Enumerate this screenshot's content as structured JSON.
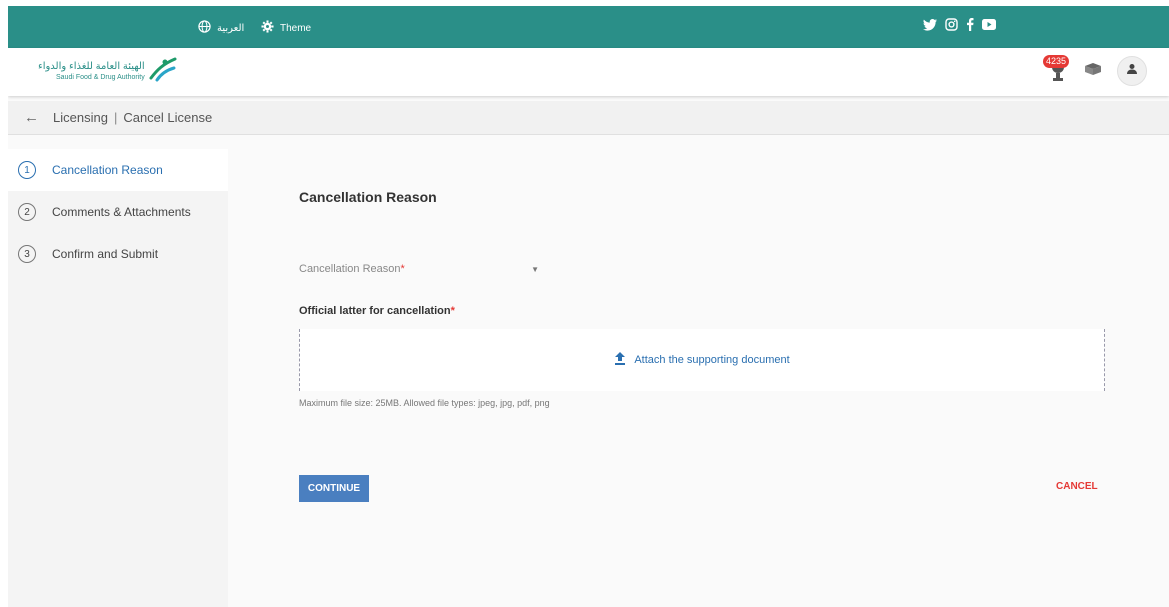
{
  "topbar": {
    "language_label": "العربية",
    "theme_label": "Theme",
    "social_icons": [
      "twitter-icon",
      "instagram-icon",
      "facebook-icon",
      "youtube-icon"
    ]
  },
  "header": {
    "logo_ar": "الهيئة العامة للغذاء والدواء",
    "logo_en": "Saudi Food & Drug Authority",
    "notification_count": "4235"
  },
  "breadcrumb": {
    "parent": "Licensing",
    "current": "Cancel License"
  },
  "steps": [
    {
      "number": "1",
      "label": "Cancellation Reason"
    },
    {
      "number": "2",
      "label": "Comments & Attachments"
    },
    {
      "number": "3",
      "label": "Confirm and Submit"
    }
  ],
  "form": {
    "section_title": "Cancellation Reason",
    "reason_label": "Cancellation Reason",
    "required_mark": "*",
    "upload_label": "Official latter for cancellation",
    "attach_text": "Attach the supporting document",
    "hint": "Maximum file size: 25MB. Allowed file types: jpeg, jpg, pdf, png",
    "continue_label": "CONTINUE",
    "cancel_label": "CANCEL"
  },
  "colors": {
    "topbar": "#2a8f88",
    "primary": "#4a7fc0",
    "danger": "#e53935"
  }
}
